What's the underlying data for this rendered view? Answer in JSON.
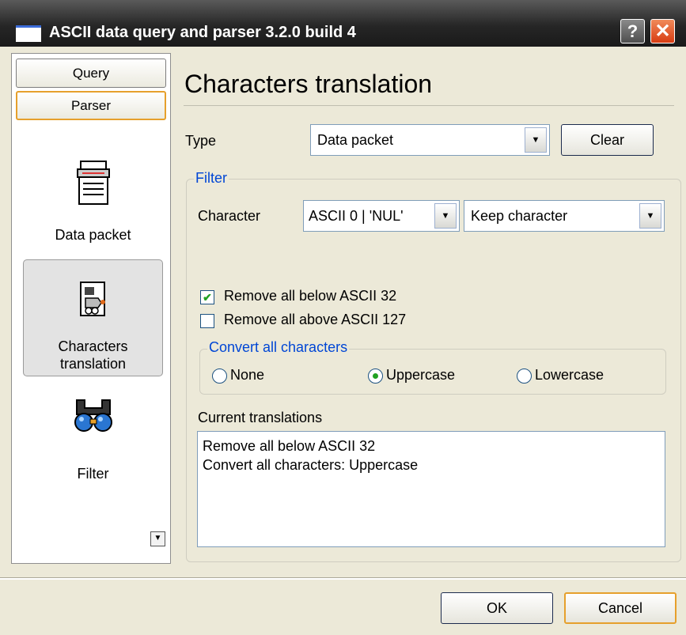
{
  "window": {
    "title": "ASCII data query and parser 3.2.0 build 4",
    "help_label": "?",
    "close_label": "✕"
  },
  "sidebar": {
    "buttons": [
      {
        "label": "Query",
        "active": false
      },
      {
        "label": "Parser",
        "active": true
      }
    ],
    "items": [
      {
        "label": "Data packet",
        "icon": "data-packet-icon"
      },
      {
        "label_line1": "Characters",
        "label_line2": "translation",
        "icon": "characters-translation-icon",
        "selected": true
      },
      {
        "label": "Filter",
        "icon": "filter-icon"
      }
    ],
    "scroll_glyph": "▼"
  },
  "main": {
    "title": "Characters translation",
    "type_label": "Type",
    "type_value": "Data packet",
    "clear_label": "Clear",
    "filter": {
      "legend": "Filter",
      "character_label": "Character",
      "character_value": "ASCII 0 | 'NUL'",
      "action_value": "Keep character"
    },
    "checkboxes": [
      {
        "label": "Remove all below ASCII 32",
        "checked": true
      },
      {
        "label": "Remove all above ASCII 127",
        "checked": false
      }
    ],
    "convert": {
      "legend": "Convert all characters",
      "options": [
        "None",
        "Uppercase",
        "Lowercase"
      ],
      "selected": "Uppercase"
    },
    "current_label": "Current translations",
    "current_lines": [
      "Remove all below ASCII 32",
      "Convert all characters: Uppercase"
    ]
  },
  "footer": {
    "ok_label": "OK",
    "cancel_label": "Cancel"
  },
  "colors": {
    "accent_orange": "#e6a02c",
    "legend_blue": "#0046d5",
    "check_green": "#21a121"
  }
}
